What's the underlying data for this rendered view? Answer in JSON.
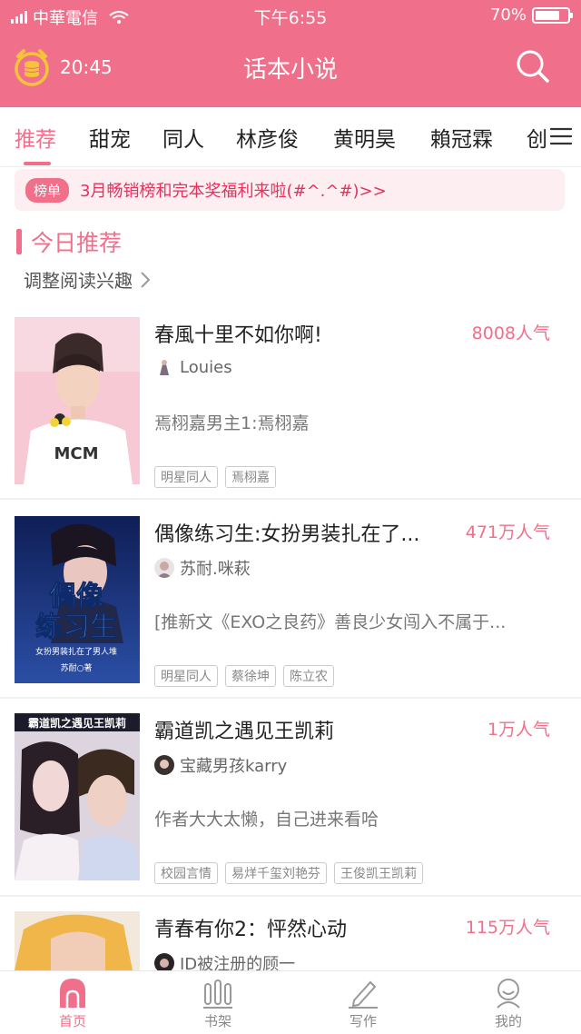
{
  "status_bar": {
    "carrier": "中華電信",
    "time": "下午6:55",
    "battery": "70%"
  },
  "header": {
    "coin_time": "20:45",
    "title": "话本小说"
  },
  "tabs": [
    "推荐",
    "甜宠",
    "同人",
    "林彦俊",
    "黄明昊",
    "賴冠霖",
    "创"
  ],
  "notice": {
    "badge": "榜单",
    "text": "3月畅销榜和完本奖福利来啦(#^.^#)>>"
  },
  "section": {
    "title": "今日推荐",
    "adjust": "调整阅读兴趣"
  },
  "books": [
    {
      "title": "春風十里不如你啊!",
      "popularity": "8008人气",
      "author": "Louies",
      "desc": "焉栩嘉男主1:焉栩嘉",
      "tags": [
        "明星同人",
        "焉栩嘉"
      ]
    },
    {
      "title": "偶像练习生:女扮男装扎在了...",
      "popularity": "471万人气",
      "author": "苏耐.咪萩",
      "desc": "[推新文《EXO之良药》善良少女闯入不属于...",
      "tags": [
        "明星同人",
        "蔡徐坤",
        "陈立农"
      ]
    },
    {
      "title": "霸道凯之遇见王凯莉",
      "popularity": "1万人气",
      "author": "宝藏男孩karry",
      "desc": "作者大大太懒，自己进来看哈",
      "tags": [
        "校园言情",
        "易烊千玺刘艳芬",
        "王俊凯王凯莉"
      ]
    },
    {
      "title": "青春有你2：怦然心动",
      "popularity": "115万人气",
      "author": "ID被注册的顾一",
      "desc": "",
      "tags": []
    }
  ],
  "cover_text": {
    "book2_main": "偶像练习生",
    "book2_sub": "女扮男装扎在了男人堆",
    "book2_author": "苏耐○著",
    "book3_banner": "霸道凯之遇见王凯莉",
    "book1_shirt": "MCM"
  },
  "bottom_nav": [
    "首页",
    "书架",
    "写作",
    "我的"
  ],
  "colors": {
    "accent": "#f0708c",
    "notice_text": "#e8305c"
  }
}
